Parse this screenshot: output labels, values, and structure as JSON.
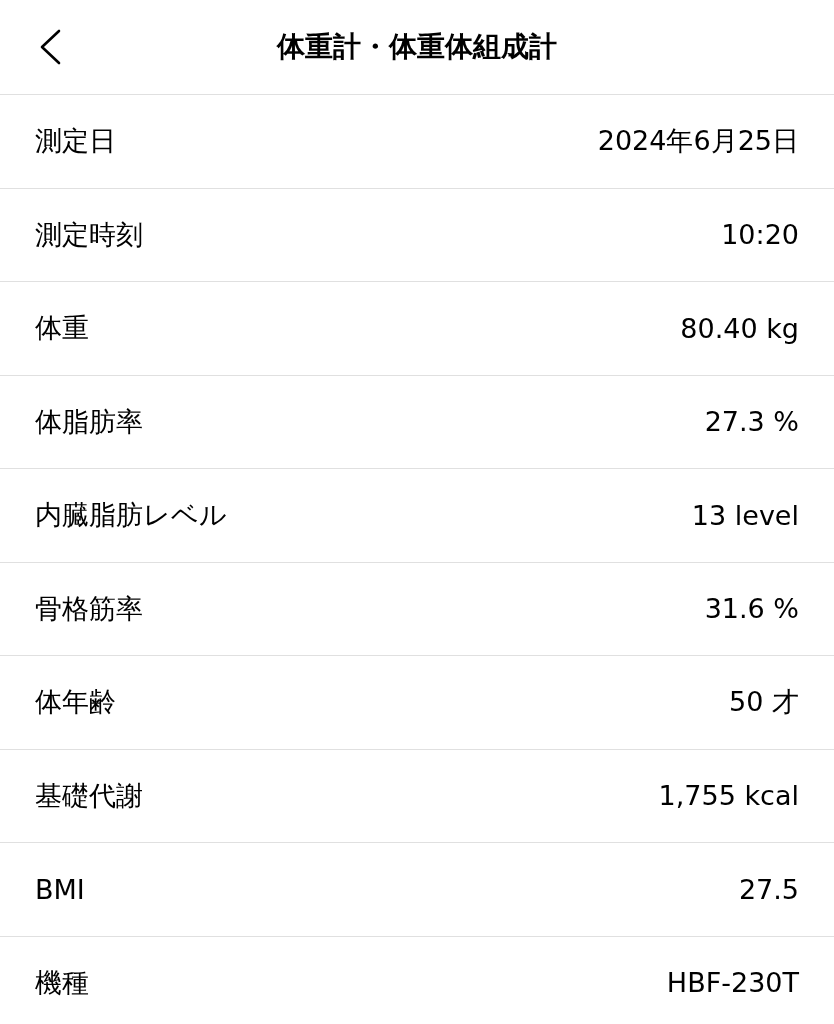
{
  "header": {
    "title": "体重計・体重体組成計"
  },
  "rows": [
    {
      "label": "測定日",
      "value": "2024年6月25日"
    },
    {
      "label": "測定時刻",
      "value": "10:20"
    },
    {
      "label": "体重",
      "value": "80.40 kg"
    },
    {
      "label": "体脂肪率",
      "value": "27.3 %"
    },
    {
      "label": "内臓脂肪レベル",
      "value": "13 level"
    },
    {
      "label": "骨格筋率",
      "value": "31.6 %"
    },
    {
      "label": "体年齢",
      "value": "50 才"
    },
    {
      "label": "基礎代謝",
      "value": "1,755 kcal"
    },
    {
      "label": "BMI",
      "value": "27.5"
    },
    {
      "label": "機種",
      "value": "HBF-230T"
    }
  ]
}
